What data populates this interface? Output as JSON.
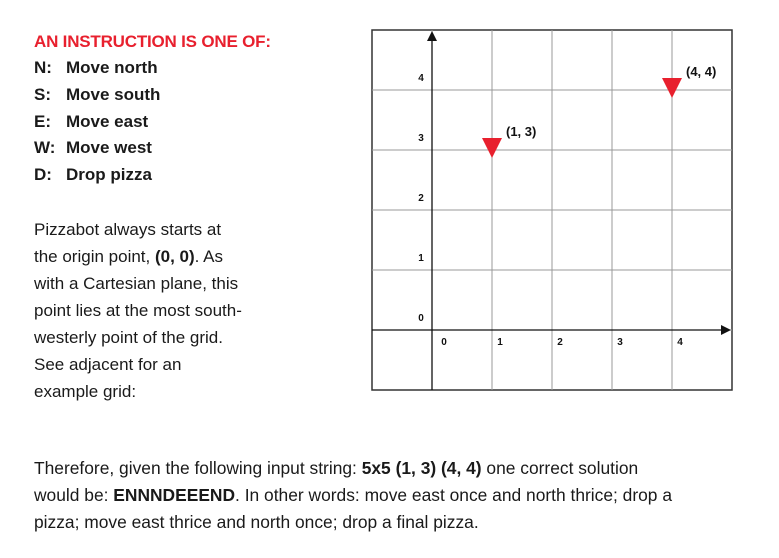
{
  "instructions": {
    "heading": "AN INSTRUCTION IS ONE OF:",
    "items": [
      {
        "key": "N:",
        "label": "Move north"
      },
      {
        "key": "S:",
        "label": "Move south"
      },
      {
        "key": "E:",
        "label": "Move east"
      },
      {
        "key": "W:",
        "label": "Move west"
      },
      {
        "key": "D:",
        "label": "Drop pizza"
      }
    ]
  },
  "description": {
    "lines": [
      [
        "Pizzabot always starts at",
        ""
      ],
      [
        "the origin point, ",
        "(0, 0)",
        ". As"
      ],
      [
        "with a Cartesian plane, this"
      ],
      [
        "point lies at the most south-"
      ],
      [
        "westerly point of the grid."
      ],
      [
        "See adjacent for an"
      ],
      [
        "example grid:"
      ]
    ]
  },
  "grid": {
    "x_ticks": [
      "0",
      "1",
      "2",
      "3",
      "4"
    ],
    "y_ticks": [
      "0",
      "1",
      "2",
      "3",
      "4"
    ],
    "marker_color": "#e8202e",
    "points": [
      {
        "x": 1,
        "y": 3,
        "label": "(1, 3)"
      },
      {
        "x": 4,
        "y": 4,
        "label": "(4, 4)"
      }
    ]
  },
  "conclusion": {
    "l1a": "Therefore, given the following input string: ",
    "l1b": "5x5 (1, 3) (4, 4)",
    "l1c": " one correct solution",
    "l2a": "would be: ",
    "l2b": "ENNNDEEEND",
    "l2c": ". In other words: move east once and north thrice; drop a",
    "l3": "pizza; move east thrice and north once; drop a final pizza."
  }
}
